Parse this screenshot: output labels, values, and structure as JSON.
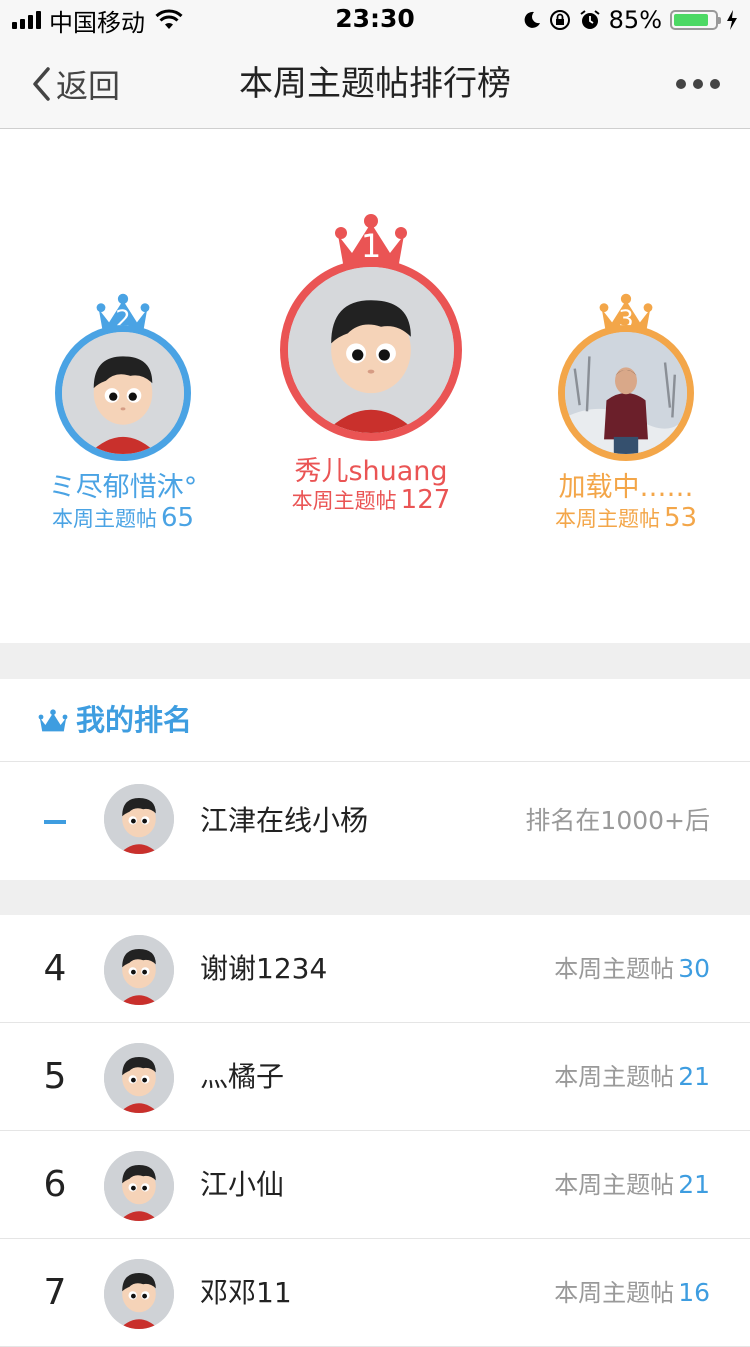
{
  "status_bar": {
    "carrier": "中国移动",
    "time": "23:30",
    "battery_percent": "85%",
    "battery_level": 0.85
  },
  "nav": {
    "back_label": "返回",
    "title": "本周主题帖排行榜"
  },
  "podium": [
    {
      "rank": "1",
      "name": "秀儿shuang",
      "label": "本周主题帖",
      "count": "127",
      "color": "#ea5454",
      "avatar": "cartoon-avatar"
    },
    {
      "rank": "2",
      "name": "ミ尽郁惜沐°",
      "label": "本周主题帖",
      "count": "65",
      "color": "#4aa3e4",
      "avatar": "cartoon-avatar"
    },
    {
      "rank": "3",
      "name": "加载中……",
      "label": "本周主题帖",
      "count": "53",
      "color": "#f3a649",
      "avatar": "photo-avatar"
    }
  ],
  "my_rank": {
    "section_title": "我的排名",
    "rank": "–",
    "name": "江津在线小杨",
    "status": "排名在1000+后"
  },
  "ranking": [
    {
      "rank": "4",
      "name": "谢谢1234",
      "label": "本周主题帖",
      "count": "30"
    },
    {
      "rank": "5",
      "name": "灬橘子",
      "label": "本周主题帖",
      "count": "21"
    },
    {
      "rank": "6",
      "name": "江小仙",
      "label": "本周主题帖",
      "count": "21"
    },
    {
      "rank": "7",
      "name": "邓邓11",
      "label": "本周主题帖",
      "count": "16"
    }
  ],
  "colors": {
    "accent_blue": "#3e9de0",
    "gold": "#ea5454",
    "silver": "#4aa3e4",
    "bronze": "#f3a649"
  }
}
